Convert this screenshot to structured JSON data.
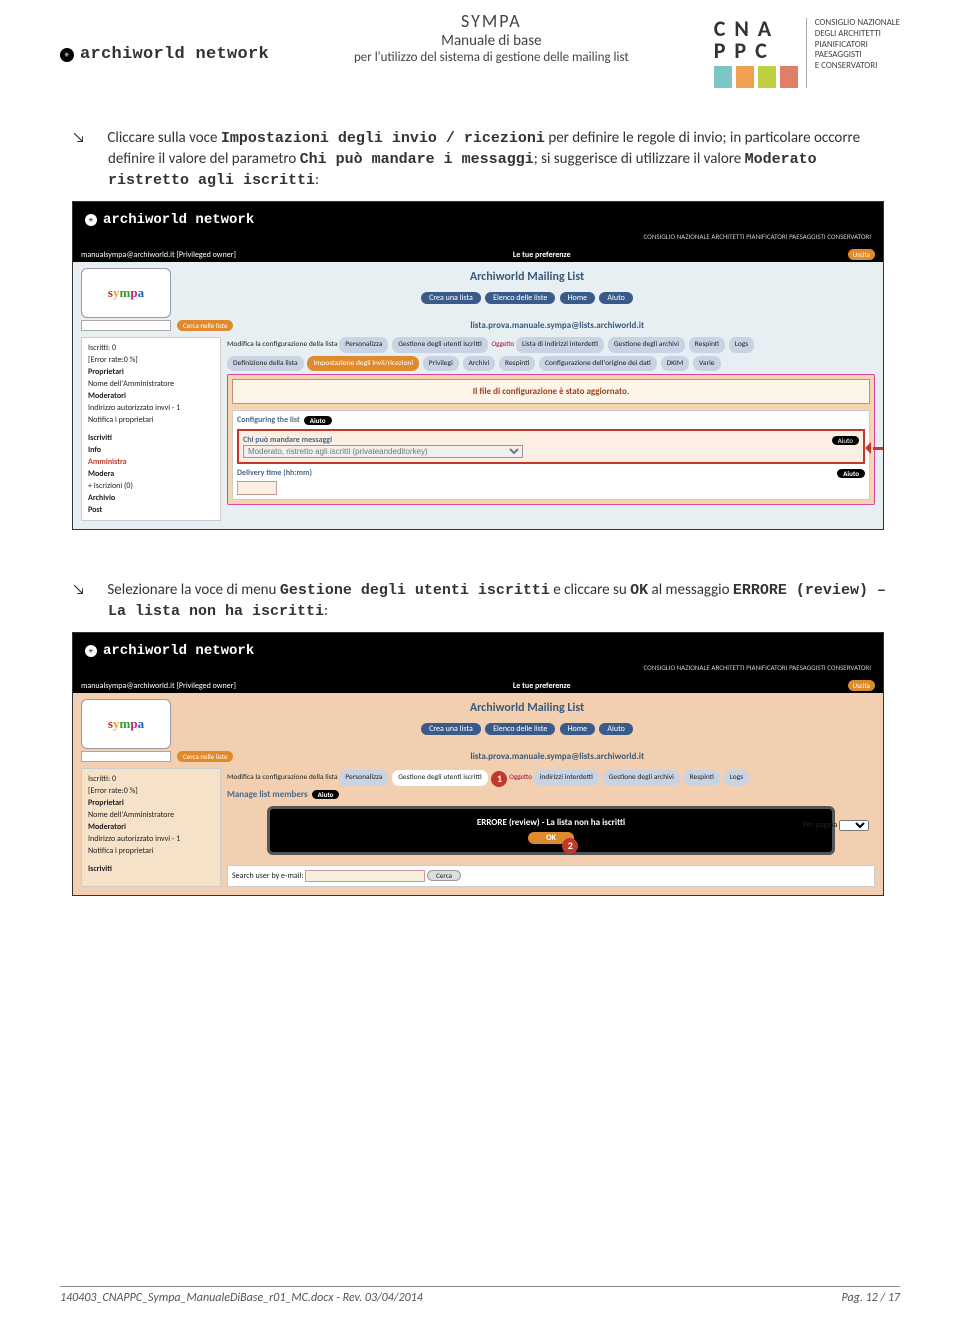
{
  "header": {
    "left_brand": "archiworld network",
    "center": {
      "line1": "SYMPA",
      "line2": "Manuale di base",
      "line3": "per l'utilizzo del sistema di gestione delle mailing list"
    },
    "right": {
      "letters_top": "C N A",
      "letters_bot": "P P C",
      "text_lines": [
        "CONSIGLIO NAZIONALE",
        "DEGLI ARCHITETTI",
        "PIANIFICATORI",
        "PAESAGGISTI",
        "E CONSERVATORI"
      ]
    }
  },
  "para1": {
    "pre": "Cliccare sulla voce ",
    "m1": "Impostazioni degli invio / ricezioni",
    "mid1": " per definire le regole di invio; in particolare occorre definire il valore del parametro ",
    "m2": "Chi può mandare i messaggi",
    "mid2": "; si suggerisce di utilizzare il valore ",
    "m3": "Moderato ristretto agli iscritti",
    "post": ":"
  },
  "shot1": {
    "brand": "archiworld network",
    "topright": "CONSIGLIO NAZIONALE ARCHITETTI PIANIFICATORI PAESAGGISTI CONSERVATORI",
    "nav_left": "manualsympa@archiworld.it [Privileged owner]",
    "nav_center": "Le tue preferenze",
    "nav_btn": "Uscita",
    "title": "Archiworld Mailing List",
    "tabs": [
      "Crea una lista",
      "Elenco delle liste",
      "Home",
      "Aiuto"
    ],
    "search_btn": "Cerca nelle liste",
    "addr": "lista.prova.manuale.sympa@lists.archiworld.it",
    "oggetto": "Oggetto",
    "left": {
      "l1": "Iscritti: 0",
      "l2": "[Error rate:0 %]",
      "l3": "Proprietari",
      "l4": "Nome dell'Amministratore",
      "l5": "Moderatori",
      "l6": "Indirizzo autorizzato invvi - 1",
      "l7": "Notifica i proprietari",
      "l8": "Iscriviti",
      "l9": "Info",
      "l10": "Amministra",
      "l11": "Modera",
      "l12": " + Iscrizioni (0)",
      "l13": "Archivio",
      "l14": "Post"
    },
    "tabs_top": {
      "intro": "Modifica la configurazione della lista",
      "items": [
        "Personalizza",
        "Gestione degli utenti iscritti",
        "Lista di indirizzi interdetti",
        "Gestione degli archivi",
        "Respinti",
        "Logs"
      ]
    },
    "tabs_bot": {
      "items": [
        "Definizione della lista",
        "Impostazione degli invii/ricezioni",
        "Privilegi",
        "Archivi",
        "Respinti",
        "Configurazione dell'origine dei dati",
        "DKIM",
        "Varie"
      ]
    },
    "configmsg": "Il file di configurazione è stato aggiornato.",
    "conftitle": "Configuring the list",
    "aiuto": "Aiuto",
    "red_label": "Chi può mandare messaggi",
    "red_select": "Moderato, ristretto agli iscritti (privateandeditorkey)",
    "delivery": "Delivery time (hh:mm)"
  },
  "para2": {
    "pre": "Selezionare la voce di menu ",
    "m1": "Gestione degli utenti iscritti",
    "mid1": " e cliccare su ",
    "m2": "OK",
    "mid2": " al messaggio ",
    "m3": "ERRORE (review) – La lista non ha iscritti",
    "post": ":"
  },
  "shot2": {
    "brand": "archiworld network",
    "topright": "CONSIGLIO NAZIONALE ARCHITETTI PIANIFICATORI PAESAGGISTI CONSERVATORI",
    "nav_left": "manualsympa@archiworld.it [Privileged owner]",
    "nav_center": "Le tue preferenze",
    "nav_btn": "Uscita",
    "title": "Archiworld Mailing List",
    "tabs": [
      "Crea una lista",
      "Elenco delle liste",
      "Home",
      "Aiuto"
    ],
    "search_btn": "Cerca nelle liste",
    "addr": "lista.prova.manuale.sympa@lists.archiworld.it",
    "oggetto": "Oggetto",
    "left": {
      "l1": "Iscritti: 0",
      "l2": "[Error rate:0 %]",
      "l3": "Proprietari",
      "l4": "Nome dell'Amministratore",
      "l5": "Moderatori",
      "l6": "Indirizzo autorizzato invvi - 1",
      "l7": "Notifica i proprietari",
      "l8": "Iscriviti"
    },
    "tabs_top": {
      "intro": "Modifica la configurazione della lista",
      "items": [
        "Personalizza",
        "Gestione degli utenti iscritti",
        "indirizzi interdetti",
        "Gestione degli archivi",
        "Respinti",
        "Logs"
      ]
    },
    "manage": "Manage list members",
    "aiuto": "Aiuto",
    "err": "ERRORE (review) - La lista non ha iscritti",
    "ok": "OK",
    "perpage": "Per pagina",
    "search": "Search user by e-mail:",
    "cerca": "Cerca"
  },
  "footer": {
    "left": "140403_CNAPPC_Sympa_ManualeDiBase_r01_MC.docx - Rev. 03/04/2014",
    "right": "Pag. 12 / 17"
  }
}
